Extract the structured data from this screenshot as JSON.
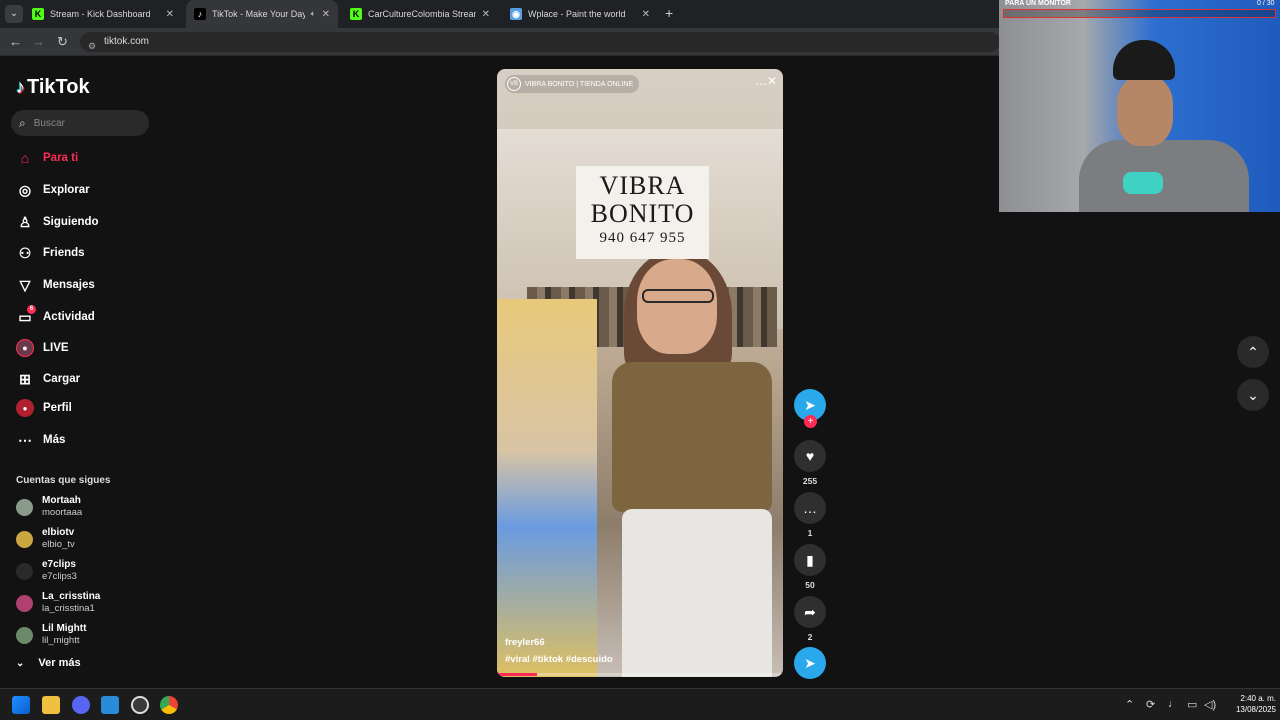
{
  "browser": {
    "tabs": [
      {
        "title": "Stream - Kick Dashboard",
        "favicon": "kick-icon",
        "color": "#53fc18",
        "glyph": "K"
      },
      {
        "title": "TikTok - Make Your Day",
        "favicon": "tiktok-icon",
        "color": "#000000",
        "glyph": "♪",
        "active": true
      },
      {
        "title": "CarCultureColombia Stream - W",
        "favicon": "kick-icon",
        "color": "#53fc18",
        "glyph": "K"
      },
      {
        "title": "Wplace - Paint the world",
        "favicon": "globe-icon",
        "color": "#5aa0e0",
        "glyph": "◉"
      }
    ],
    "url": "tiktok.com"
  },
  "sidebar": {
    "logo": "TikTok",
    "search_placeholder": "Buscar",
    "menu": [
      {
        "label": "Para ti",
        "icon": "home-icon",
        "glyph": "⌂",
        "active": true
      },
      {
        "label": "Explorar",
        "icon": "compass-icon",
        "glyph": "◎"
      },
      {
        "label": "Siguiendo",
        "icon": "following-icon",
        "glyph": "♙"
      },
      {
        "label": "Friends",
        "icon": "friends-icon",
        "glyph": "⚇"
      },
      {
        "label": "Mensajes",
        "icon": "messages-icon",
        "glyph": "▽"
      },
      {
        "label": "Actividad",
        "icon": "activity-icon",
        "glyph": "▭",
        "badge": "6"
      },
      {
        "label": "LIVE",
        "icon": "live-icon",
        "glyph": "●"
      },
      {
        "label": "Cargar",
        "icon": "upload-icon",
        "glyph": "⊞"
      },
      {
        "label": "Perfil",
        "icon": "profile-icon",
        "glyph": "●"
      },
      {
        "label": "Más",
        "icon": "more-icon",
        "glyph": "⋯"
      }
    ],
    "following_title": "Cuentas que sigues",
    "following": [
      {
        "name": "Mortaah",
        "handle": "moortaaa",
        "color": "#8a9a8a"
      },
      {
        "name": "elbiotv",
        "handle": "elbio_tv",
        "color": "#c9a640"
      },
      {
        "name": "e7clips",
        "handle": "e7clips3",
        "color": "#2a2a2a"
      },
      {
        "name": "La_crisstina",
        "handle": "la_crisstina1",
        "color": "#b04070"
      },
      {
        "name": "Lil Mightt",
        "handle": "lil_mightt",
        "color": "#6a8a6a"
      }
    ],
    "see_more": "Ver más"
  },
  "video": {
    "account_label": "VIBRA BONITO | TIENDA ONLINE",
    "logo_text": "VB",
    "sign_line1": "VIBRA",
    "sign_line2": "BONITO",
    "sign_phone": "940 647 955",
    "author": "freyler66",
    "hashtags": "#viral  #tiktok  #descuido",
    "progress": 0.14
  },
  "actions": {
    "likes": "255",
    "comments": "1",
    "saves": "50",
    "shares": "2"
  },
  "webcam": {
    "label": "PARA UN MONITOR",
    "count": "0 / 30",
    "goal_progress": 0
  },
  "taskbar": {
    "time": "2:40 a. m.",
    "date": "13/08/2025"
  }
}
